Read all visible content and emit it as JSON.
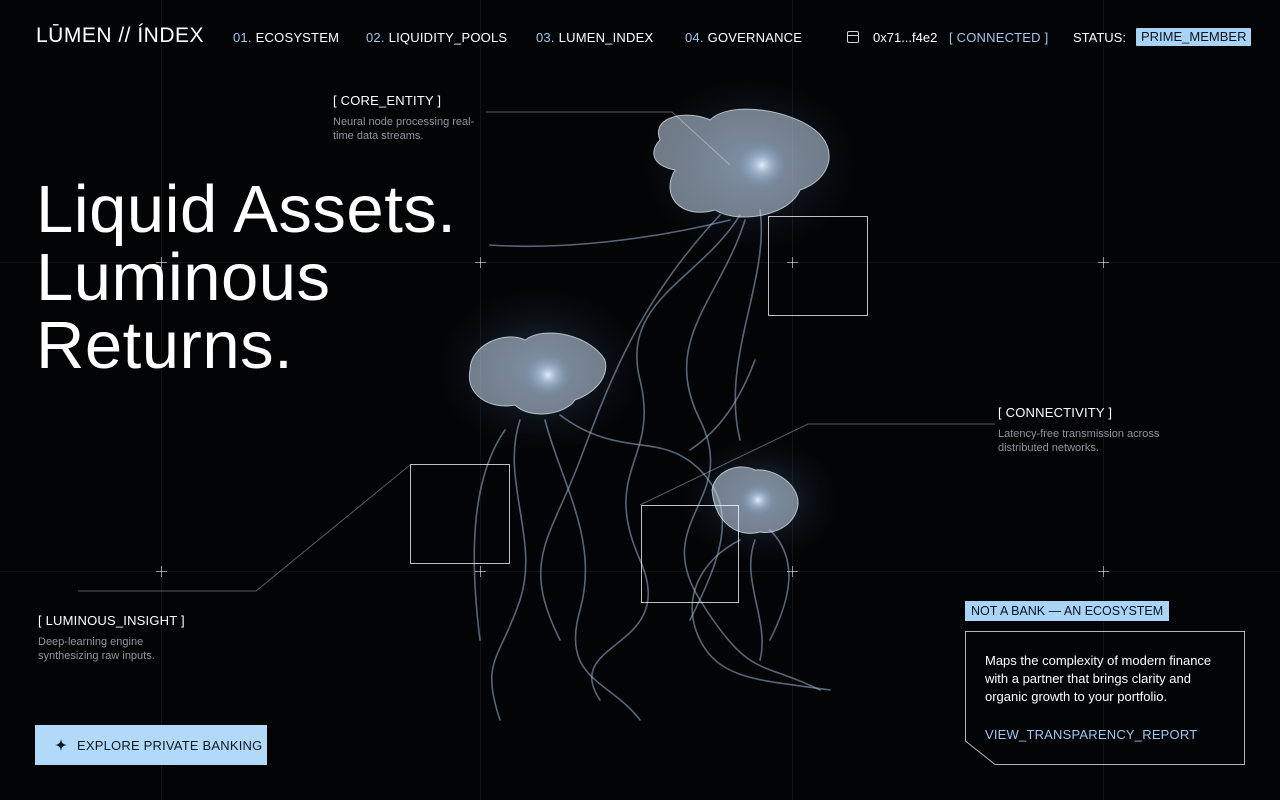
{
  "brand": "LŪMEN // ÍNDEX",
  "nav": [
    {
      "num": "01.",
      "label": "ECOSYSTEM"
    },
    {
      "num": "02.",
      "label": "LIQUIDITY_POOLS"
    },
    {
      "num": "03.",
      "label": "LUMEN_INDEX"
    },
    {
      "num": "04.",
      "label": "GOVERNANCE"
    }
  ],
  "wallet": {
    "address": "0x71...f4e2",
    "connection": "[ CONNECTED ]",
    "icon": "wallet-icon"
  },
  "status": {
    "label": "STATUS:",
    "badge": "PRIME_MEMBER"
  },
  "hero": {
    "line1": "Liquid Assets.",
    "line2": "Luminous",
    "line3": "Returns."
  },
  "callouts": {
    "core": {
      "title": "[ CORE_ENTITY ]",
      "desc_line1": "Neural node processing real-",
      "desc_line2": "time data streams."
    },
    "connectivity": {
      "title": "[ CONNECTIVITY ]",
      "desc_line1": "Latency-free transmission across",
      "desc_line2": "distributed networks."
    },
    "insight": {
      "title": "[ LUMINOUS_INSIGHT ]",
      "desc_line1": "Deep-learning engine",
      "desc_line2": "synthesizing raw inputs."
    }
  },
  "cta": {
    "label": "EXPLORE PRIVATE BANKING",
    "icon": "sparkle-icon"
  },
  "card": {
    "tag": "NOT A BANK — AN ECOSYSTEM",
    "body": "Maps the complexity of modern finance with a partner that brings clarity and organic growth to your portfolio.",
    "link": "VIEW_TRANSPARENCY_REPORT"
  },
  "colors": {
    "accent": "#a9d3f7",
    "accent_text": "#9fc6ee",
    "background": "#030405"
  }
}
